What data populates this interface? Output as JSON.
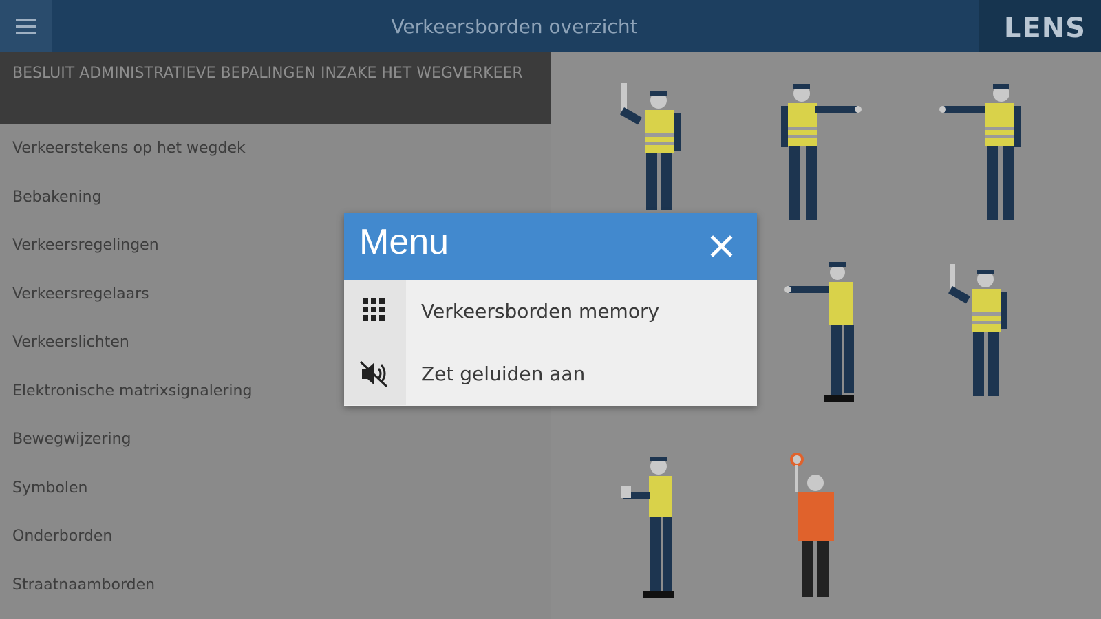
{
  "header": {
    "title": "Verkeersborden overzicht",
    "logo": "LENS",
    "menu_icon": "hamburger-icon"
  },
  "sidebar": {
    "section_title": "BESLUIT ADMINISTRATIEVE BEPALINGEN INZAKE HET WEGVERKEER",
    "items": [
      {
        "label": "Verkeerstekens op het wegdek"
      },
      {
        "label": "Bebakening"
      },
      {
        "label": "Verkeersregelingen"
      },
      {
        "label": "Verkeersregelaars"
      },
      {
        "label": "Verkeerslichten"
      },
      {
        "label": "Elektronische matrixsignalering"
      },
      {
        "label": "Bewegwijzering"
      },
      {
        "label": "Symbolen"
      },
      {
        "label": "Onderborden"
      },
      {
        "label": "Straatnaamborden"
      }
    ]
  },
  "modal": {
    "title": "Menu",
    "close_icon": "close-icon",
    "items": [
      {
        "label": "Verkeersborden memory",
        "icon": "grid-icon"
      },
      {
        "label": "Zet geluiden aan",
        "icon": "sound-muted-icon"
      }
    ]
  },
  "colors": {
    "topbar": "#1d3f60",
    "modal_header": "#4289ce",
    "vest_yellow": "#d9d24a",
    "vest_orange": "#e0622c"
  }
}
